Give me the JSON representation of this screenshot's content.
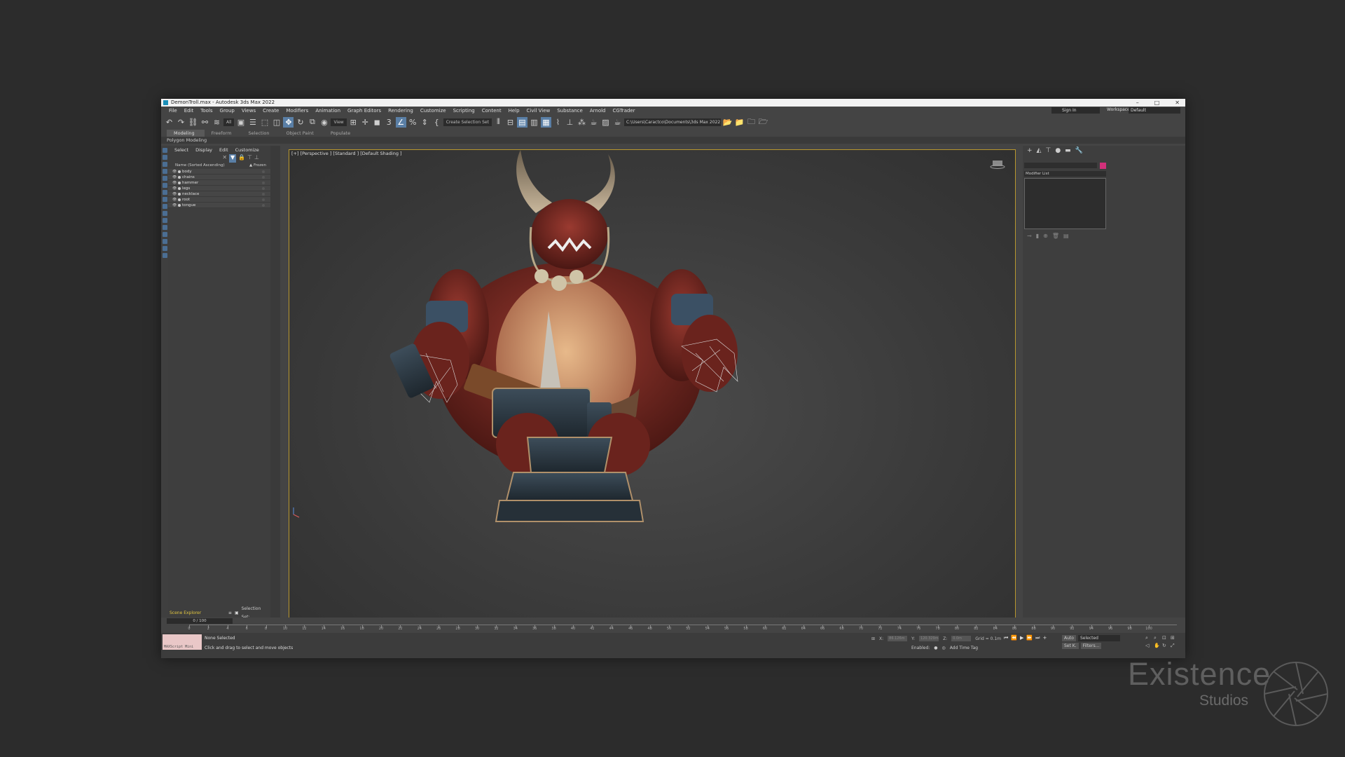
{
  "window": {
    "title": "DemonTroll.max - Autodesk 3ds Max 2022",
    "buttons": [
      "–",
      "□",
      "✕"
    ]
  },
  "menu": [
    "File",
    "Edit",
    "Tools",
    "Group",
    "Views",
    "Create",
    "Modifiers",
    "Animation",
    "Graph Editors",
    "Rendering",
    "Customize",
    "Scripting",
    "Content",
    "Help",
    "Civil View",
    "Substance",
    "Arnold",
    "CGTrader"
  ],
  "signin": "Sign In",
  "workspaces_label": "Workspaces:",
  "workspace_value": "Default",
  "toolbar": {
    "filter_value": "All",
    "view_value": "View",
    "selection_set": "Create Selection Set",
    "project_path": "C:\\Users\\Caractco\\Documents\\3ds Max 2022"
  },
  "ribbon": {
    "tabs": [
      "Modeling",
      "Freeform",
      "Selection",
      "Object Paint",
      "Populate"
    ],
    "subtitle": "Polygon Modeling"
  },
  "explorer": {
    "menu": [
      "Select",
      "Display",
      "Edit",
      "Customize"
    ],
    "header_name": "Name (Sorted Ascending)",
    "header_frozen": "▲ Frozen",
    "items": [
      "body",
      "chains",
      "hammer",
      "legs",
      "necklace",
      "root",
      "tongue"
    ],
    "footer_label": "Scene Explorer",
    "selection_set_label": "Selection Set:"
  },
  "viewport": {
    "label": "[+] [Perspective ] [Standard ] [Default Shading ]"
  },
  "right_panel": {
    "modifier_list": "Modifier List",
    "object_color": "#d1307a"
  },
  "timeline": {
    "frame_display": "0 / 100",
    "ticks": [
      0,
      2,
      4,
      6,
      8,
      10,
      12,
      14,
      16,
      18,
      20,
      22,
      24,
      26,
      28,
      30,
      32,
      34,
      36,
      38,
      40,
      42,
      44,
      46,
      48,
      50,
      52,
      54,
      56,
      58,
      60,
      62,
      64,
      66,
      68,
      70,
      72,
      74,
      76,
      78,
      80,
      82,
      84,
      86,
      88,
      90,
      92,
      94,
      96,
      98,
      100
    ]
  },
  "status": {
    "maxscript": "MAXScript Mini",
    "line1": "None Selected",
    "line2": "Click and drag to select and move objects",
    "x_label": "X:",
    "x_value": "86.126m",
    "y_label": "Y:",
    "y_value": "120.329m",
    "z_label": "Z:",
    "z_value": "0.0m",
    "grid": "Grid = 0.1m",
    "enabled": "Enabled:",
    "add_time_tag": "Add Time Tag",
    "auto": "Auto",
    "selected": "Selected",
    "set_key": "Set K.",
    "filters": "Filters...",
    "frame": "0"
  },
  "watermark": {
    "title": "Existence",
    "subtitle": "Studios"
  }
}
